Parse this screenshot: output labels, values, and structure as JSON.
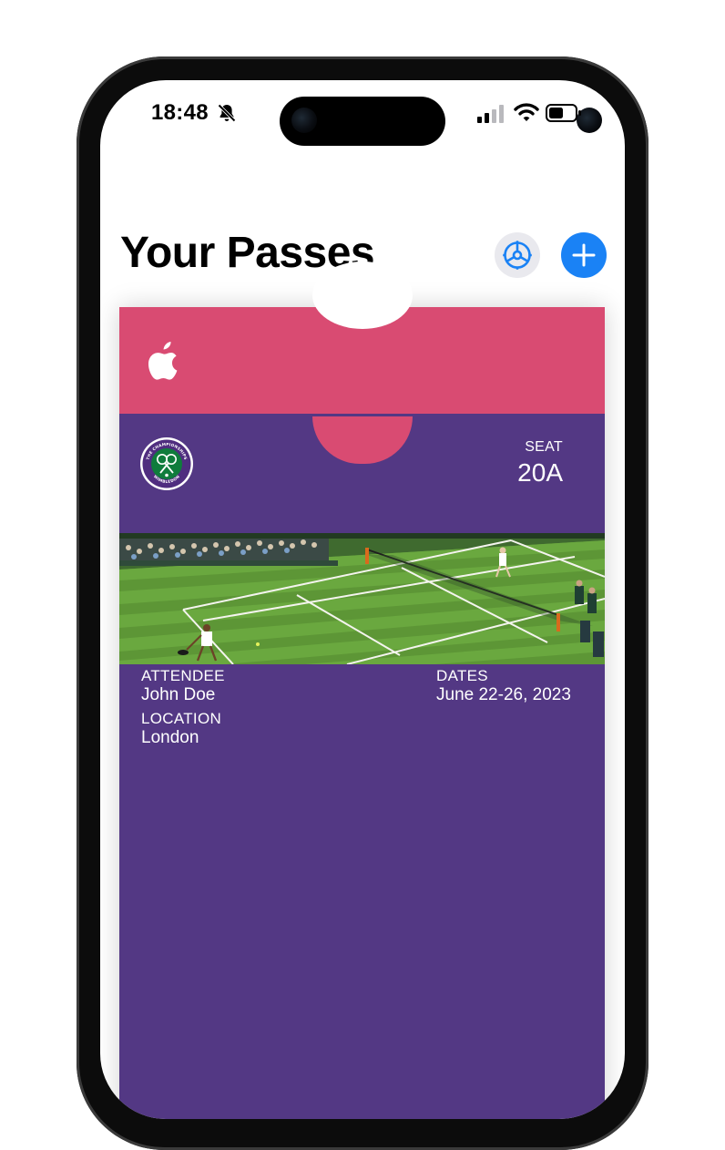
{
  "status_bar": {
    "time": "18:48",
    "icons": [
      "bell-slash-icon",
      "cellular-signal-icon",
      "wifi-icon",
      "battery-icon"
    ]
  },
  "header": {
    "title": "Your Passes",
    "settings_icon": "gear-icon",
    "add_icon": "plus-icon"
  },
  "pass": {
    "header_color": "#d94b72",
    "body_color": "#533884",
    "header_logo": "apple-logo-icon",
    "event_logo": "wimbledon-logo-icon",
    "event_logo_text": "THE CHAMPIONSHIPS WIMBLEDON",
    "seat_label": "SEAT",
    "seat_value": "20A",
    "image": "tennis-court-image",
    "attendee_label": "ATTENDEE",
    "attendee_value": "John Doe",
    "location_label": "LOCATION",
    "location_value": "London",
    "dates_label": "DATES",
    "dates_value": "June 22-26, 2023"
  },
  "colors": {
    "accent_blue": "#1a82f5",
    "settings_bg": "#e9e9ee"
  }
}
